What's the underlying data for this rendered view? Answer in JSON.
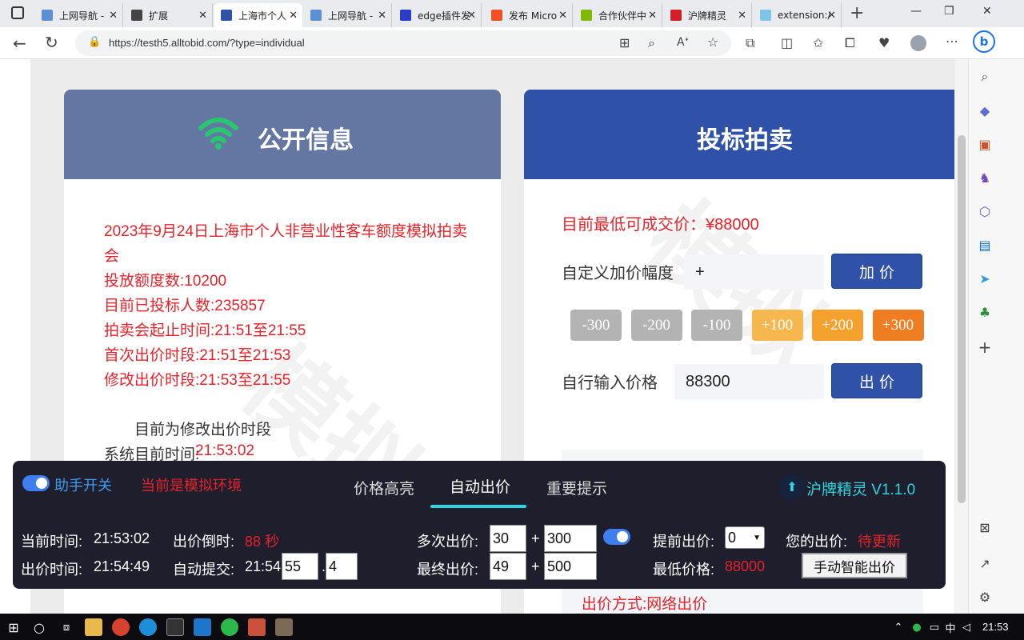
{
  "browser": {
    "tabs": [
      {
        "title": "上网导航 -",
        "fav_color": "#5b8fd6"
      },
      {
        "title": "扩展",
        "fav_color": "#444"
      },
      {
        "title": "上海市个人",
        "fav_color": "#2f52a8"
      },
      {
        "title": "上网导航 -",
        "fav_color": "#5b8fd6"
      },
      {
        "title": "edge插件发",
        "fav_color": "#2b3cc7"
      },
      {
        "title": "发布 Micro",
        "fav_color": "#f25022"
      },
      {
        "title": "合作伙伴中",
        "fav_color": "#7fba00"
      },
      {
        "title": "沪牌精灵",
        "fav_color": "#d21f2a"
      },
      {
        "title": "extension:/",
        "fav_color": "#7ec6e8"
      }
    ],
    "url": "https://testh5.alltobid.com/?type=individual",
    "new_tab_label": "+"
  },
  "left_card": {
    "title": "公开信息",
    "lines": [
      "2023年9月24日上海市个人非营业性客车额度模拟拍卖",
      "会",
      "投放额度数:10200",
      "目前已投标人数:235857",
      "拍卖会起止时间:21:51至21:55",
      "首次出价时段:21:51至21:53",
      "修改出价时段:21:53至21:55"
    ],
    "phase": "目前为修改出价时段",
    "sys_time_label": "系统目前时间:",
    "sys_time_value": "21:53:02"
  },
  "right_card": {
    "title": "投标拍卖",
    "min_price": "目前最低可成交价：¥88000",
    "custom_label": "自定义加价幅度",
    "custom_value": "+",
    "add_btn": "加 价",
    "increments": [
      {
        "label": "-300",
        "color": "#b3b3b3"
      },
      {
        "label": "-200",
        "color": "#b3b3b3"
      },
      {
        "label": "-100",
        "color": "#b3b3b3"
      },
      {
        "label": "+100",
        "color": "#f7b74f"
      },
      {
        "label": "+200",
        "color": "#f4a12e"
      },
      {
        "label": "+300",
        "color": "#ef7d22"
      }
    ],
    "price_label": "自行输入价格",
    "price_value": "88300",
    "bid_btn": "出 价",
    "bid_method": "出价方式:网络出价"
  },
  "panel": {
    "switch_label": "助手开关",
    "env_label": "当前是模拟环境",
    "tabs": [
      "价格高亮",
      "自动出价",
      "重要提示"
    ],
    "active_tab": "自动出价",
    "brand": "沪牌精灵 V1.1.0",
    "row1": {
      "cur_time_label": "当前时间:",
      "cur_time": "21:53:02",
      "countdown_label": "出价倒时:",
      "countdown": "88 秒",
      "multi_label": "多次出价:",
      "multi_sec": "30",
      "plus1": "+",
      "multi_add": "300",
      "advance_label": "提前出价:",
      "advance_value": "0",
      "your_price_label": "您的出价:",
      "your_price": "待更新"
    },
    "row2": {
      "bid_time_label": "出价时间:",
      "bid_time": "21:54:49",
      "auto_label": "自动提交:",
      "auto_prefix": "21:54:",
      "auto_sec": "55",
      "dot": ".",
      "auto_ms": "4",
      "final_label": "最终出价:",
      "final_sec": "49",
      "plus2": "+",
      "final_add": "500",
      "min_label": "最低价格:",
      "min_value": "88000",
      "manual_btn": "手动智能出价"
    }
  },
  "taskbar": {
    "time": "21:53"
  },
  "colors": {
    "left_header": "#6477a3",
    "right_header": "#2f52a8",
    "red_text": "#e5222a",
    "panel_bg": "#1e1e2d",
    "accent_cyan": "#2fd5e0"
  }
}
